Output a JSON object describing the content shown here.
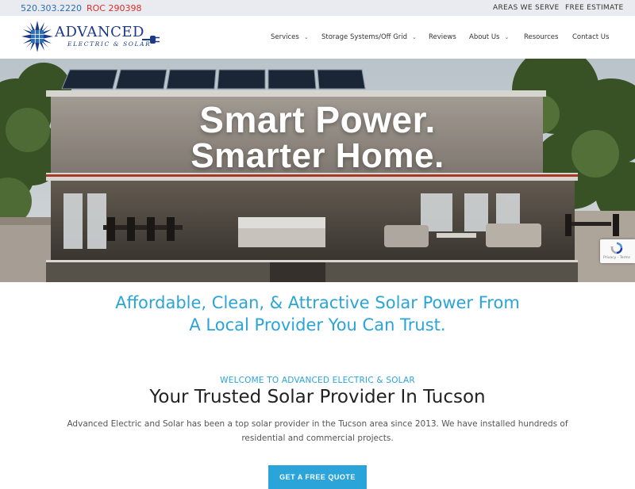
{
  "topbar": {
    "phone": "520.303.2220",
    "roc": "ROC 290398",
    "links": [
      "AREAS WE SERVE",
      "FREE ESTIMATE"
    ]
  },
  "logo": {
    "brand": "ADVANCED",
    "tagline": "ELECTRIC & SOLAR"
  },
  "nav": [
    {
      "label": "Services",
      "dropdown": true
    },
    {
      "label": "Storage Systems/Off Grid",
      "dropdown": true
    },
    {
      "label": "Reviews",
      "dropdown": false
    },
    {
      "label": "About Us",
      "dropdown": true
    },
    {
      "label": "Resources",
      "dropdown": false
    },
    {
      "label": "Contact Us",
      "dropdown": false
    }
  ],
  "hero": {
    "line1": "Smart Power.",
    "line2": "Smarter Home."
  },
  "recaptcha": {
    "text": "Privacy - Terms"
  },
  "tagline": {
    "line1": "Affordable, Clean, & Attractive Solar Power From",
    "line2": "A Local Provider You Can Trust."
  },
  "welcome": "WELCOME TO ADVANCED ELECTRIC & SOLAR",
  "heading": "Your Trusted Solar Provider In Tucson",
  "description": "Advanced Electric and Solar has been a top solar provider in the Tucson area since 2013. We have installed hundreds of residential and commercial projects.",
  "cta": "GET A FREE QUOTE",
  "colors": {
    "accent": "#2aa4d9",
    "brand": "#1c3a8a",
    "phone": "#2c6fb2",
    "roc": "#d9302c",
    "topbar_bg": "#e9ebf0"
  }
}
